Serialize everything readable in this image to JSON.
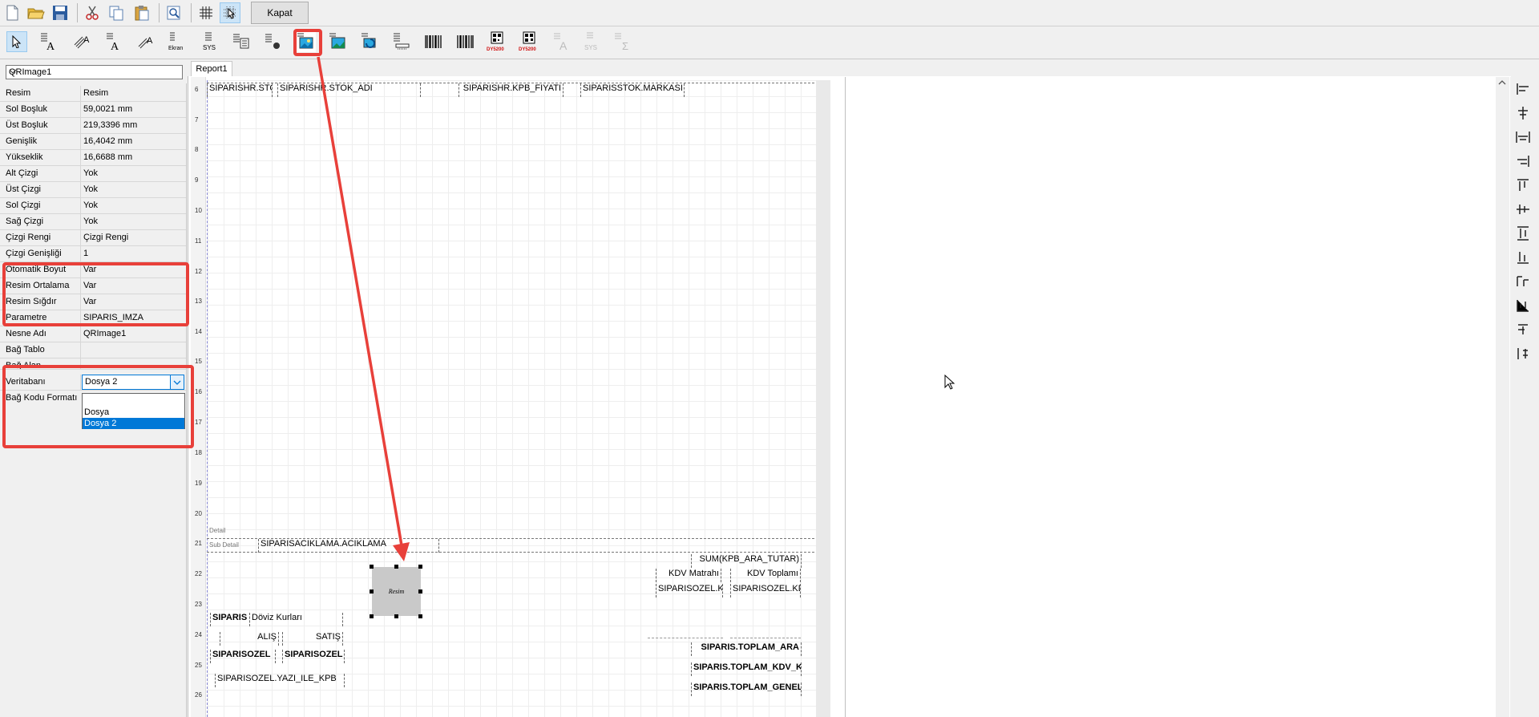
{
  "toolbar": {
    "close_label": "Kapat"
  },
  "tabs": {
    "report": "Report1"
  },
  "object_selector": {
    "value": "QRImage1"
  },
  "properties": [
    {
      "key": "Resim",
      "value": "Resim"
    },
    {
      "key": "Sol Boşluk",
      "value": "59,0021 mm"
    },
    {
      "key": "Üst Boşluk",
      "value": "219,3396 mm"
    },
    {
      "key": "Genişlik",
      "value": "16,4042 mm"
    },
    {
      "key": "Yükseklik",
      "value": "16,6688 mm"
    },
    {
      "key": "Alt Çizgi",
      "value": "Yok"
    },
    {
      "key": "Üst Çizgi",
      "value": "Yok"
    },
    {
      "key": "Sol Çizgi",
      "value": "Yok"
    },
    {
      "key": "Sağ Çizgi",
      "value": "Yok"
    },
    {
      "key": "Çizgi Rengi",
      "value": "Çizgi Rengi"
    },
    {
      "key": "Çizgi Genişliği",
      "value": "1"
    },
    {
      "key": "Otomatik Boyut",
      "value": "Var"
    },
    {
      "key": "Resim Ortalama",
      "value": "Var"
    },
    {
      "key": "Resim Sığdır",
      "value": "Var"
    },
    {
      "key": "Parametre",
      "value": "SIPARIS_IMZA"
    },
    {
      "key": "Nesne Adı",
      "value": "QRImage1"
    },
    {
      "key": "Bağ Tablo",
      "value": ""
    },
    {
      "key": "Bağ Alan",
      "value": ""
    },
    {
      "key": "Veritabanı",
      "value": "Dosya 2"
    },
    {
      "key": "Bağ Kodu Formatı",
      "value": ""
    }
  ],
  "database_dropdown": {
    "options": [
      "Dosya",
      "Dosya 2"
    ],
    "selected": "Dosya 2"
  },
  "ruler": [
    "6",
    "7",
    "8",
    "9",
    "10",
    "11",
    "12",
    "13",
    "14",
    "15",
    "16",
    "17",
    "18",
    "19",
    "20",
    "21",
    "22",
    "23",
    "24",
    "25",
    "26"
  ],
  "bands": {
    "detail": "Detail",
    "sub_detail": "Sub Detail"
  },
  "report_fields": {
    "stok_kodu": "SIPARISHR.STO",
    "stok_adi": "SIPARISHR.STOK_ADI",
    "kpb_fiyati": "SIPARISHR.KPB_FIYATI",
    "stok_markasi": "SIPARISSTOK.MARKASI",
    "aciklama": "SIPARISACIKLAMA.ACIKLAMA",
    "image_label": "Resim",
    "sum_ara_tutar": "SUM(KPB_ARA_TUTAR)",
    "kdv_matrahi": "KDV Matrahı",
    "kdv_toplami": "KDV Toplamı",
    "ozel_kd1": "SIPARISOZEL.KD",
    "ozel_kd2": "SIPARISOZEL.KD",
    "siparis": "SIPARIS",
    "doviz_kurlari": "Döviz Kurları",
    "alis": "ALIŞ",
    "satis": "SATIŞ",
    "ozel1": "SIPARISOZEL",
    "ozel2": "SIPARISOZEL",
    "yazi_ile": "SIPARISOZEL.YAZI_ILE_KPB",
    "toplam_ara": "SIPARIS.TOPLAM_ARA",
    "toplam_kdv": "SIPARIS.TOPLAM_KDV_K",
    "toplam_genel": "SIPARIS.TOPLAM_GENEL"
  },
  "toolbar2_icons": {
    "sys_label": "SYS",
    "ekran_label": "Ekran",
    "qr_label": "DY5200"
  },
  "colors": {
    "highlight": "#e8403a",
    "selection": "#0078d7"
  }
}
